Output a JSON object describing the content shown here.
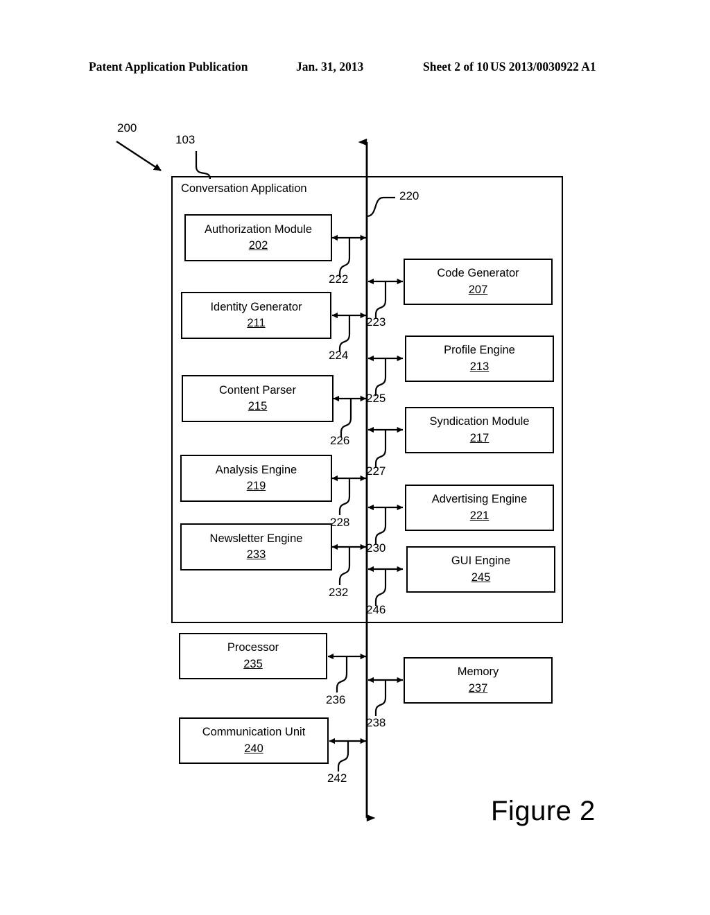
{
  "header": {
    "publication": "Patent Application Publication",
    "date": "Jan. 31, 2013",
    "sheet": "Sheet 2 of 10",
    "patent_number": "US 2013/0030922 A1"
  },
  "figure": {
    "caption": "Figure 2",
    "diagram_ref": "200",
    "container_ref": "103",
    "container_title": "Conversation Application",
    "bus_ref": "220"
  },
  "blocks": {
    "left_inside": [
      {
        "label": "Authorization Module",
        "number": "202",
        "conn_ref": "222"
      },
      {
        "label": "Identity Generator",
        "number": "211",
        "conn_ref": "224"
      },
      {
        "label": "Content Parser",
        "number": "215",
        "conn_ref": "226"
      },
      {
        "label": "Analysis Engine",
        "number": "219",
        "conn_ref": "228"
      },
      {
        "label": "Newsletter Engine",
        "number": "233",
        "conn_ref": "232"
      }
    ],
    "right_inside": [
      {
        "label": "Code Generator",
        "number": "207",
        "conn_ref": "223"
      },
      {
        "label": "Profile Engine",
        "number": "213",
        "conn_ref": "225"
      },
      {
        "label": "Syndication Module",
        "number": "217",
        "conn_ref": "227"
      },
      {
        "label": "Advertising Engine",
        "number": "221",
        "conn_ref": "230"
      },
      {
        "label": "GUI Engine",
        "number": "245",
        "conn_ref": "246"
      }
    ],
    "left_outside": [
      {
        "label": "Processor",
        "number": "235",
        "conn_ref": "236"
      },
      {
        "label": "Communication Unit",
        "number": "240",
        "conn_ref": "242"
      }
    ],
    "right_outside": [
      {
        "label": "Memory",
        "number": "237",
        "conn_ref": "238"
      }
    ]
  }
}
